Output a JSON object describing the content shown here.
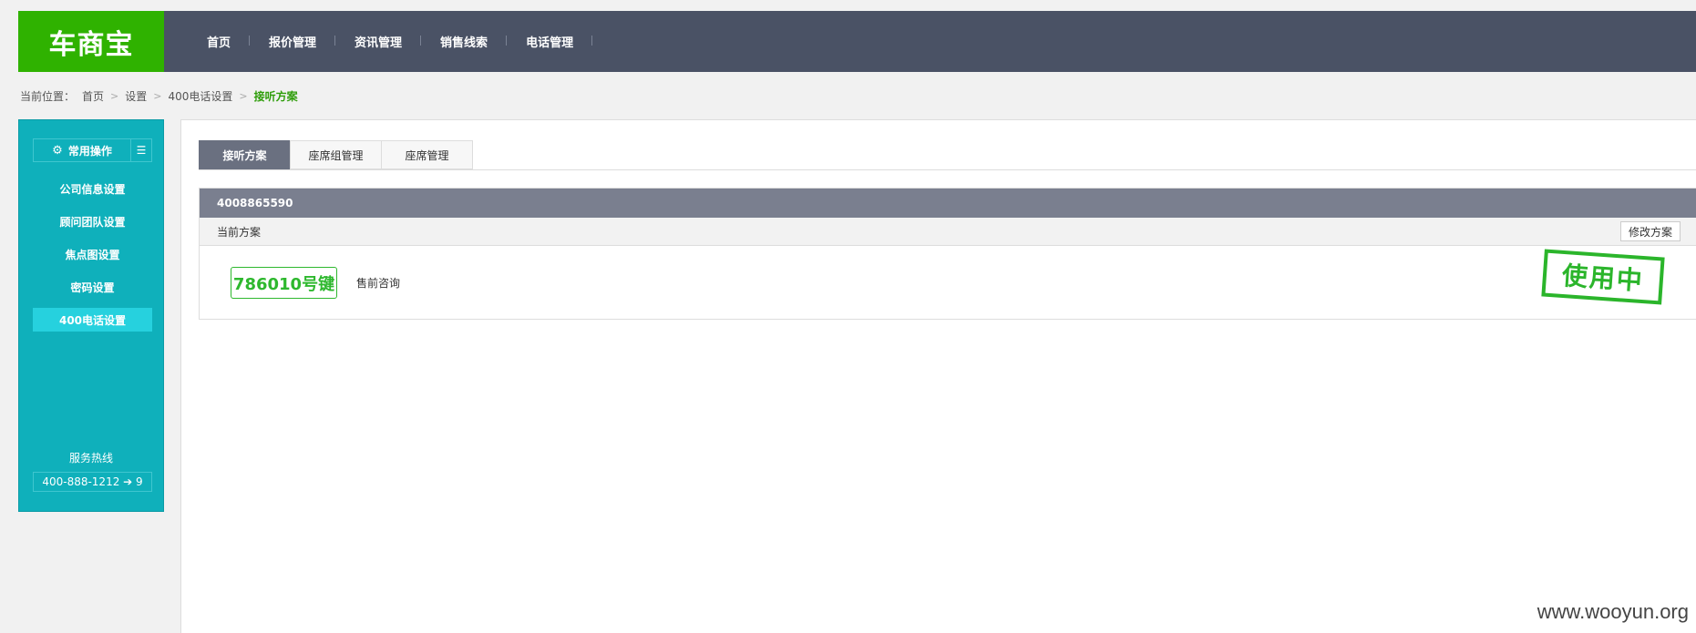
{
  "header": {
    "logo": "车商宝",
    "nav": [
      "首页",
      "报价管理",
      "资讯管理",
      "销售线索",
      "电话管理"
    ]
  },
  "breadcrumb": {
    "lead": "当前位置：",
    "items": [
      "首页",
      "设置",
      "400电话设置"
    ],
    "current": "接听方案"
  },
  "sidebar": {
    "header_label": "常用操作",
    "header_icon": "gear-icon",
    "menu_icon": "list-icon",
    "items": [
      "公司信息设置",
      "顾问团队设置",
      "焦点图设置",
      "密码设置",
      "400电话设置"
    ],
    "active_index": 4,
    "hotline_title": "服务热线",
    "hotline_number": "400-888-1212 ➔ 9"
  },
  "tabs": [
    "接听方案",
    "座席组管理",
    "座席管理"
  ],
  "active_tab": 0,
  "panel": {
    "phone": "4008865590",
    "current_plan_label": "当前方案",
    "edit_button": "修改方案",
    "key_badge": "786010号键",
    "key_label": "售前咨询",
    "stamp": "使用中"
  },
  "watermark": "www.wooyun.org",
  "colors": {
    "logo_green": "#2fb200",
    "topbar": "#4a5265",
    "sidebar_teal": "#0fb0bb",
    "active_tab": "#6a7080",
    "accent_green": "#2eb82e"
  }
}
